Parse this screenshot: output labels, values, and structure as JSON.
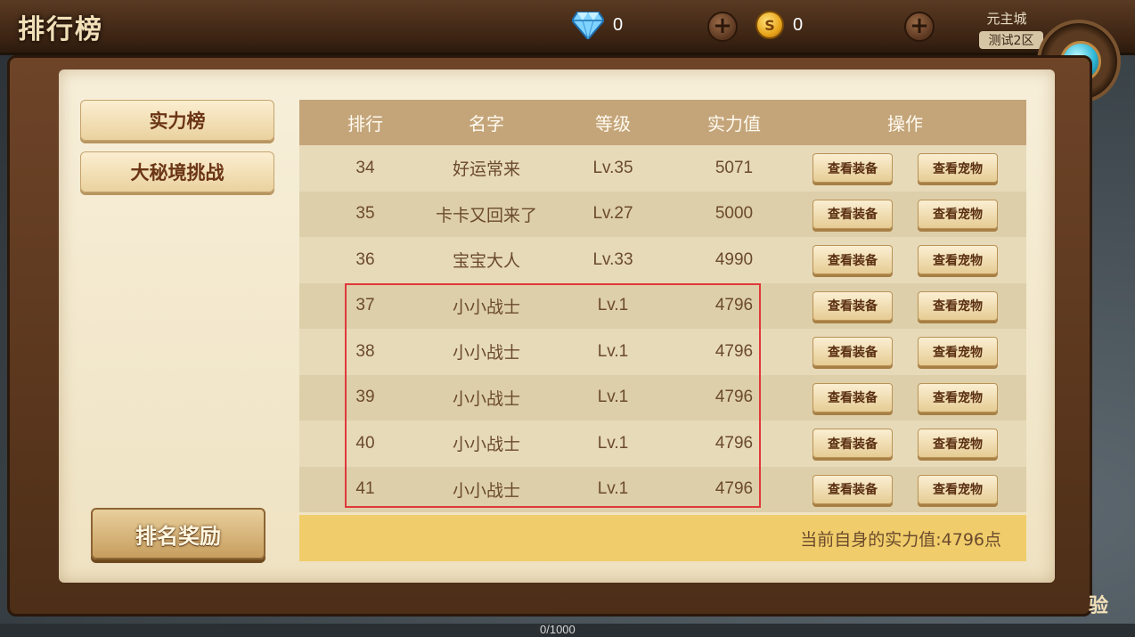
{
  "header": {
    "title": "排行榜",
    "diamond_count": "0",
    "coin_count": "0",
    "coin_glyph": "S",
    "plus_glyph": "+",
    "server_line1": "元主城",
    "server_line2": "测试2区"
  },
  "sidebar": {
    "tabs": [
      {
        "label": "实力榜"
      },
      {
        "label": "大秘境挑战"
      }
    ],
    "reward_button": "排名奖励"
  },
  "table": {
    "headers": {
      "rank": "排行",
      "name": "名字",
      "level": "等级",
      "power": "实力值",
      "action": "操作"
    },
    "rows": [
      {
        "rank": "34",
        "name": "好运常来",
        "level": "Lv.35",
        "power": "5071",
        "btn1": "查看装备",
        "btn2": "查看宠物"
      },
      {
        "rank": "35",
        "name": "卡卡又回来了",
        "level": "Lv.27",
        "power": "5000",
        "btn1": "查看装备",
        "btn2": "查看宠物"
      },
      {
        "rank": "36",
        "name": "宝宝大人",
        "level": "Lv.33",
        "power": "4990",
        "btn1": "查看装备",
        "btn2": "查看宠物"
      },
      {
        "rank": "37",
        "name": "小小战士",
        "level": "Lv.1",
        "power": "4796",
        "btn1": "查看装备",
        "btn2": "查看宠物"
      },
      {
        "rank": "38",
        "name": "小小战士",
        "level": "Lv.1",
        "power": "4796",
        "btn1": "查看装备",
        "btn2": "查看宠物"
      },
      {
        "rank": "39",
        "name": "小小战士",
        "level": "Lv.1",
        "power": "4796",
        "btn1": "查看装备",
        "btn2": "查看宠物"
      },
      {
        "rank": "40",
        "name": "小小战士",
        "level": "Lv.1",
        "power": "4796",
        "btn1": "查看装备",
        "btn2": "查看宠物"
      },
      {
        "rank": "41",
        "name": "小小战士",
        "level": "Lv.1",
        "power": "4796",
        "btn1": "查看装备",
        "btn2": "查看宠物"
      }
    ],
    "self_power": "当前自身的实力值:4796点"
  },
  "bottom": {
    "progress_text": "0/1000",
    "edge_glyph": "验"
  },
  "colors": {
    "highlight_border": "#e0383a",
    "footer_bar": "#f0cd6a"
  }
}
